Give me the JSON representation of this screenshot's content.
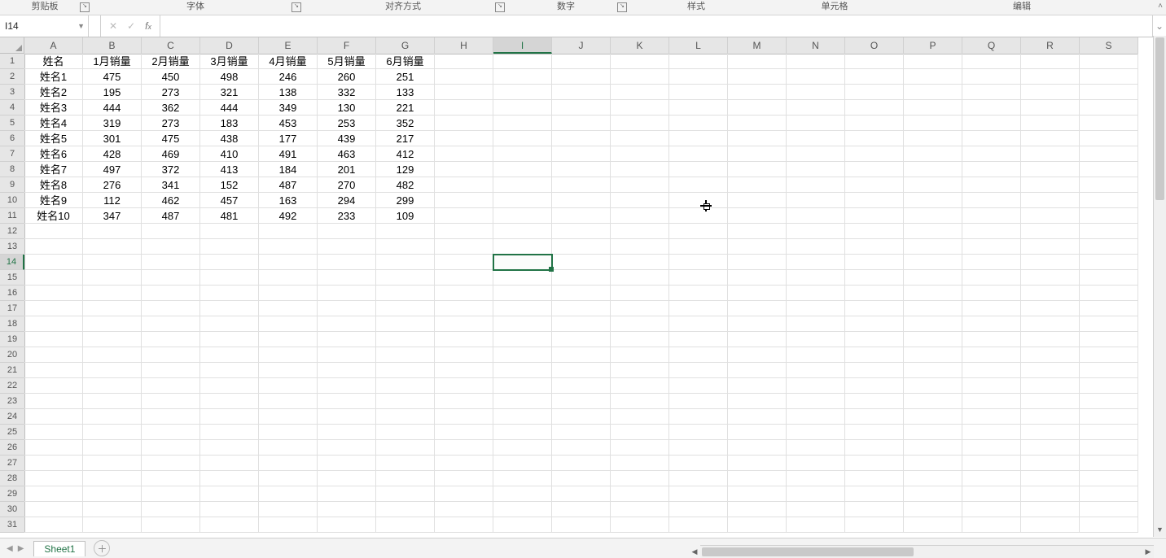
{
  "ribbon_groups": {
    "clipboard": "剪贴板",
    "font": "字体",
    "alignment": "对齐方式",
    "number": "数字",
    "styles": "样式",
    "cells": "单元格",
    "editing": "编辑"
  },
  "namebox": {
    "value": "I14"
  },
  "formula_bar": {
    "value": ""
  },
  "columns": [
    "A",
    "B",
    "C",
    "D",
    "E",
    "F",
    "G",
    "H",
    "I",
    "J",
    "K",
    "L",
    "M",
    "N",
    "O",
    "P",
    "Q",
    "R",
    "S"
  ],
  "active_column_index": 8,
  "active_row_index": 13,
  "row_count": 31,
  "table": {
    "headers": [
      "姓名",
      "1月销量",
      "2月销量",
      "3月销量",
      "4月销量",
      "5月销量",
      "6月销量"
    ],
    "rows": [
      {
        "name": "姓名1",
        "v": [
          475,
          450,
          498,
          246,
          260,
          251
        ]
      },
      {
        "name": "姓名2",
        "v": [
          195,
          273,
          321,
          138,
          332,
          133
        ]
      },
      {
        "name": "姓名3",
        "v": [
          444,
          362,
          444,
          349,
          130,
          221
        ]
      },
      {
        "name": "姓名4",
        "v": [
          319,
          273,
          183,
          453,
          253,
          352
        ]
      },
      {
        "name": "姓名5",
        "v": [
          301,
          475,
          438,
          177,
          439,
          217
        ]
      },
      {
        "name": "姓名6",
        "v": [
          428,
          469,
          410,
          491,
          463,
          412
        ]
      },
      {
        "name": "姓名7",
        "v": [
          497,
          372,
          413,
          184,
          201,
          129
        ]
      },
      {
        "name": "姓名8",
        "v": [
          276,
          341,
          152,
          487,
          270,
          482
        ]
      },
      {
        "name": "姓名9",
        "v": [
          112,
          462,
          457,
          163,
          294,
          299
        ]
      },
      {
        "name": "姓名10",
        "v": [
          347,
          487,
          481,
          492,
          233,
          109
        ]
      }
    ]
  },
  "sheet_tab": {
    "name": "Sheet1"
  }
}
